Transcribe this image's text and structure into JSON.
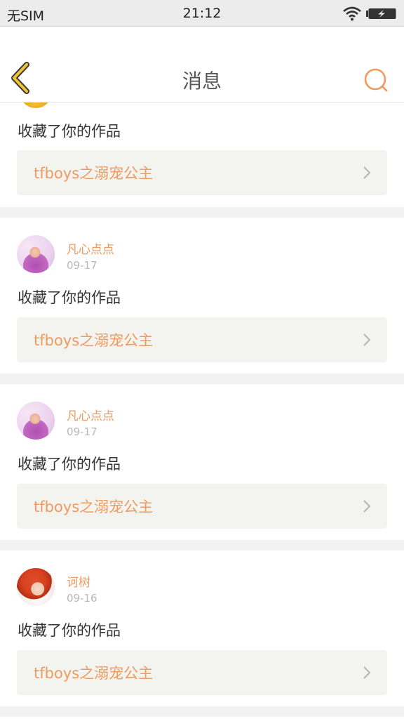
{
  "status_bar": {
    "carrier": "无SIM",
    "time": "21:12",
    "wifi_icon": "wifi-icon",
    "battery_icon": "battery-charging-icon"
  },
  "nav": {
    "title": "消息",
    "back_icon": "chevron-left-icon",
    "search_icon": "search-icon"
  },
  "colors": {
    "accent": "#ef9a5e",
    "back_arrow": "#f1c232",
    "card_bg": "#f3f3ef",
    "separator": "#f2f2f2"
  },
  "partial_message": {
    "action": "收藏了你的作品",
    "work_title": "tfboys之溺宠公主"
  },
  "messages": [
    {
      "username": "凡心点点",
      "date": "09-17",
      "action": "收藏了你的作品",
      "work_title": "tfboys之溺宠公主",
      "avatar": "baby-avatar"
    },
    {
      "username": "凡心点点",
      "date": "09-17",
      "action": "收藏了你的作品",
      "work_title": "tfboys之溺宠公主",
      "avatar": "baby-avatar"
    },
    {
      "username": "诃树",
      "date": "09-16",
      "action": "收藏了你的作品",
      "work_title": "tfboys之溺宠公主",
      "avatar": "anime-avatar"
    }
  ]
}
